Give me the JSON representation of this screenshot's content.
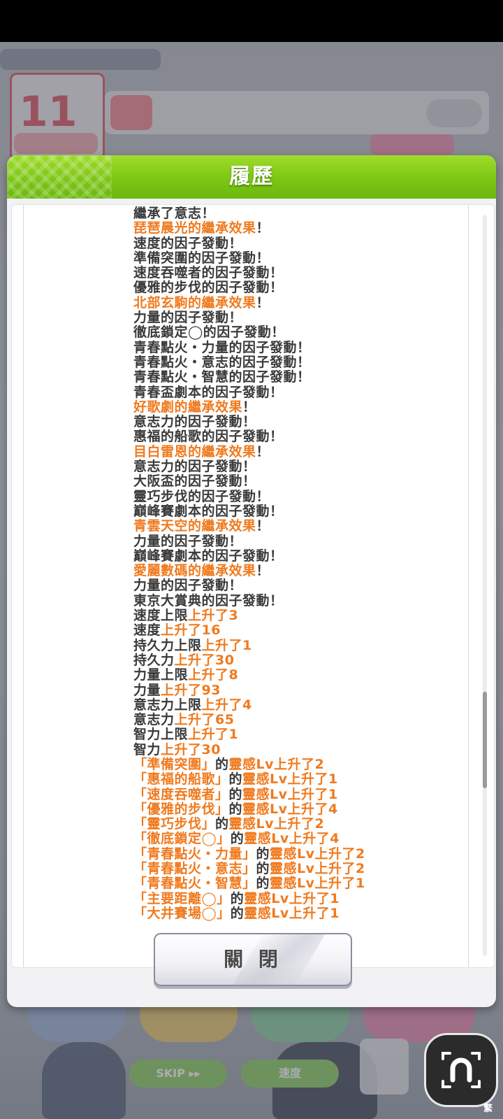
{
  "dialog": {
    "title": "履歷",
    "close_label": "關 閉"
  },
  "background": {
    "top_number": "11",
    "top_small": "",
    "pills": [
      "SKIP ▸▸",
      "速度"
    ],
    "menu_labels": [
      "",
      "",
      "",
      ""
    ]
  },
  "corner": {
    "label": "繁"
  },
  "log": [
    [
      {
        "t": "繼承了意志！",
        "h": false
      }
    ],
    [
      {
        "t": "琵琶晨光的繼承效果",
        "h": true
      },
      {
        "t": "！",
        "h": false
      }
    ],
    [
      {
        "t": "速度的因子發動！",
        "h": false
      }
    ],
    [
      {
        "t": "準備突圍的因子發動！",
        "h": false
      }
    ],
    [
      {
        "t": "速度吞噬者的因子發動！",
        "h": false
      }
    ],
    [
      {
        "t": "優雅的步伐的因子發動！",
        "h": false
      }
    ],
    [
      {
        "t": "北部玄駒的繼承效果",
        "h": true
      },
      {
        "t": "！",
        "h": false
      }
    ],
    [
      {
        "t": "力量的因子發動！",
        "h": false
      }
    ],
    [
      {
        "t": "徹底鎖定◯的因子發動！",
        "h": false
      }
    ],
    [
      {
        "t": "青春點火・力量的因子發動！",
        "h": false
      }
    ],
    [
      {
        "t": "青春點火・意志的因子發動！",
        "h": false
      }
    ],
    [
      {
        "t": "青春點火・智慧的因子發動！",
        "h": false
      }
    ],
    [
      {
        "t": "青春盃劇本的因子發動！",
        "h": false
      }
    ],
    [
      {
        "t": "好歌劇的繼承效果",
        "h": true
      },
      {
        "t": "！",
        "h": false
      }
    ],
    [
      {
        "t": "意志力的因子發動！",
        "h": false
      }
    ],
    [
      {
        "t": "惠福的船歌的因子發動！",
        "h": false
      }
    ],
    [
      {
        "t": "目白雷恩的繼承效果",
        "h": true
      },
      {
        "t": "！",
        "h": false
      }
    ],
    [
      {
        "t": "意志力的因子發動！",
        "h": false
      }
    ],
    [
      {
        "t": "大阪盃的因子發動！",
        "h": false
      }
    ],
    [
      {
        "t": "靈巧步伐的因子發動！",
        "h": false
      }
    ],
    [
      {
        "t": "巔峰賽劇本的因子發動！",
        "h": false
      }
    ],
    [
      {
        "t": "青雲天空的繼承效果",
        "h": true
      },
      {
        "t": "！",
        "h": false
      }
    ],
    [
      {
        "t": "力量的因子發動！",
        "h": false
      }
    ],
    [
      {
        "t": "巔峰賽劇本的因子發動！",
        "h": false
      }
    ],
    [
      {
        "t": "愛麗數碼的繼承效果",
        "h": true
      },
      {
        "t": "！",
        "h": false
      }
    ],
    [
      {
        "t": "力量的因子發動！",
        "h": false
      }
    ],
    [
      {
        "t": "東京大賞典的因子發動！",
        "h": false
      }
    ],
    [
      {
        "t": "速度上限",
        "h": false
      },
      {
        "t": "上升了3",
        "h": true
      }
    ],
    [
      {
        "t": "速度",
        "h": false
      },
      {
        "t": "上升了16",
        "h": true
      }
    ],
    [
      {
        "t": "持久力上限",
        "h": false
      },
      {
        "t": "上升了1",
        "h": true
      }
    ],
    [
      {
        "t": "持久力",
        "h": false
      },
      {
        "t": "上升了30",
        "h": true
      }
    ],
    [
      {
        "t": "力量上限",
        "h": false
      },
      {
        "t": "上升了8",
        "h": true
      }
    ],
    [
      {
        "t": "力量",
        "h": false
      },
      {
        "t": "上升了93",
        "h": true
      }
    ],
    [
      {
        "t": "意志力上限",
        "h": false
      },
      {
        "t": "上升了4",
        "h": true
      }
    ],
    [
      {
        "t": "意志力",
        "h": false
      },
      {
        "t": "上升了65",
        "h": true
      }
    ],
    [
      {
        "t": "智力上限",
        "h": false
      },
      {
        "t": "上升了1",
        "h": true
      }
    ],
    [
      {
        "t": "智力",
        "h": false
      },
      {
        "t": "上升了30",
        "h": true
      }
    ],
    [
      {
        "t": "「準備突圍」",
        "h": true
      },
      {
        "t": "的",
        "h": false
      },
      {
        "t": "靈感Lv上升了2",
        "h": true
      }
    ],
    [
      {
        "t": "「惠福的船歌」",
        "h": true
      },
      {
        "t": "的",
        "h": false
      },
      {
        "t": "靈感Lv上升了1",
        "h": true
      }
    ],
    [
      {
        "t": "「速度吞噬者」",
        "h": true
      },
      {
        "t": "的",
        "h": false
      },
      {
        "t": "靈感Lv上升了1",
        "h": true
      }
    ],
    [
      {
        "t": "「優雅的步伐」",
        "h": true
      },
      {
        "t": "的",
        "h": false
      },
      {
        "t": "靈感Lv上升了4",
        "h": true
      }
    ],
    [
      {
        "t": "「靈巧步伐」",
        "h": true
      },
      {
        "t": "的",
        "h": false
      },
      {
        "t": "靈感Lv上升了2",
        "h": true
      }
    ],
    [
      {
        "t": "「徹底鎖定◯」",
        "h": true
      },
      {
        "t": "的",
        "h": false
      },
      {
        "t": "靈感Lv上升了4",
        "h": true
      }
    ],
    [
      {
        "t": "「青春點火・力量」",
        "h": true
      },
      {
        "t": "的",
        "h": false
      },
      {
        "t": "靈感Lv上升了2",
        "h": true
      }
    ],
    [
      {
        "t": "「青春點火・意志」",
        "h": true
      },
      {
        "t": "的",
        "h": false
      },
      {
        "t": "靈感Lv上升了2",
        "h": true
      }
    ],
    [
      {
        "t": "「青春點火・智慧」",
        "h": true
      },
      {
        "t": "的",
        "h": false
      },
      {
        "t": "靈感Lv上升了1",
        "h": true
      }
    ],
    [
      {
        "t": "「主要距離◯」",
        "h": true
      },
      {
        "t": "的",
        "h": false
      },
      {
        "t": "靈感Lv上升了1",
        "h": true
      }
    ],
    [
      {
        "t": "「大井賽場◯」",
        "h": true
      },
      {
        "t": "的",
        "h": false
      },
      {
        "t": "靈感Lv上升了1",
        "h": true
      }
    ]
  ],
  "colors": {
    "header_green": "#7cc614",
    "highlight_orange": "#f07a1e",
    "text_dark": "#3a3a3a"
  },
  "scroll": {
    "position_fraction": 0.74
  }
}
